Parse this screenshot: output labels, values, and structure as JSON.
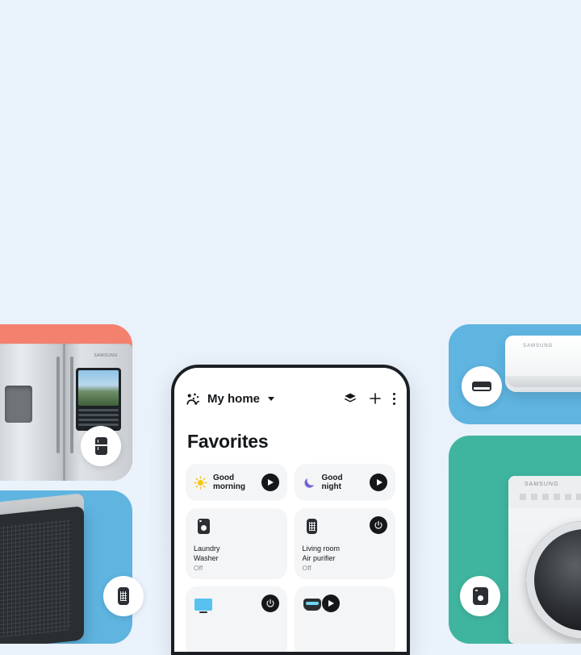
{
  "page": {
    "background_color": "#eaf2fb"
  },
  "tiles": [
    {
      "id": "refrigerator",
      "color": "#f4806e",
      "brand": "SAMSUNG",
      "badge_icon": "refrigerator-icon"
    },
    {
      "id": "air-dresser",
      "color": "#5fb4e0",
      "badge_icon": "air-dresser-icon"
    },
    {
      "id": "air-conditioner",
      "color": "#5fb4e0",
      "brand": "SAMSUNG",
      "badge_icon": "air-conditioner-icon"
    },
    {
      "id": "washer",
      "color": "#3fb5a0",
      "brand": "SAMSUNG",
      "badge_icon": "washer-icon"
    }
  ],
  "phone": {
    "app_bar": {
      "home_icon": "smartthings-home-icon",
      "title": "My home",
      "dropdown_icon": "chevron-down-icon",
      "actions": [
        {
          "name": "layers-icon",
          "label": ""
        },
        {
          "name": "add-icon",
          "label": "+"
        },
        {
          "name": "more-options-icon",
          "label": ""
        }
      ]
    },
    "page_title": "Favorites",
    "scenes": [
      {
        "label": "Good morning",
        "icon": "sun-icon",
        "accent": "#f5c518",
        "play_label": "▶"
      },
      {
        "label": "Good night",
        "icon": "moon-icon",
        "accent": "#6f63d6",
        "play_label": "▶"
      }
    ],
    "devices": [
      {
        "icon": "washer-icon",
        "room": "Laundry",
        "name": "Washer",
        "status": "Off",
        "control": "none"
      },
      {
        "icon": "air-purifier-icon",
        "room": "Living room",
        "name": "Air purifier",
        "status": "Off",
        "control": "power-button"
      },
      {
        "icon": "tv-icon",
        "room": "",
        "name": "",
        "status": "",
        "control": "power-button"
      },
      {
        "icon": "robot-vacuum-icon",
        "room": "",
        "name": "",
        "status": "",
        "control": "play-button"
      }
    ]
  }
}
